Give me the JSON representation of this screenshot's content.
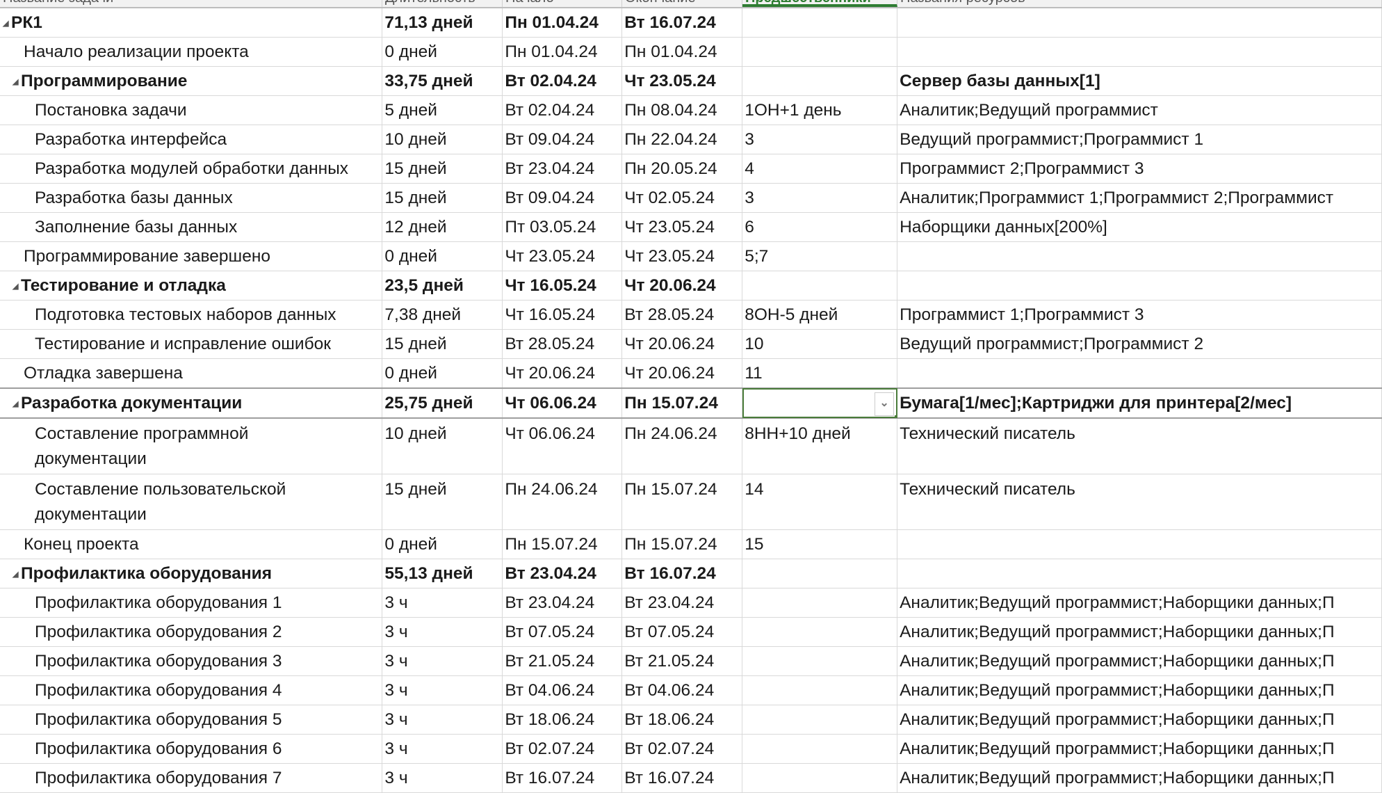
{
  "columns": [
    "Название задачи",
    "Длительность",
    "Начало",
    "Окончание",
    "Предшественники",
    "Названия ресурсов"
  ],
  "selected_column": 4,
  "rows": [
    {
      "name": "РК1",
      "duration": "71,13 дней",
      "start": "Пн 01.04.24",
      "finish": "Вт 16.07.24",
      "pred": "",
      "res": "",
      "level": 0,
      "summary": true
    },
    {
      "name": "Начало реализации проекта",
      "duration": "0 дней",
      "start": "Пн 01.04.24",
      "finish": "Пн 01.04.24",
      "pred": "",
      "res": "",
      "level": 1
    },
    {
      "name": "Программирование",
      "duration": "33,75 дней",
      "start": "Вт 02.04.24",
      "finish": "Чт 23.05.24",
      "pred": "",
      "res": "Сервер базы данных[1]",
      "level": 1,
      "summary": true
    },
    {
      "name": "Постановка задачи",
      "duration": "5 дней",
      "start": "Вт 02.04.24",
      "finish": "Пн 08.04.24",
      "pred": "1ОН+1 день",
      "res": "Аналитик;Ведущий программист",
      "level": 2
    },
    {
      "name": "Разработка интерфейса",
      "duration": "10 дней",
      "start": "Вт 09.04.24",
      "finish": "Пн 22.04.24",
      "pred": "3",
      "res": "Ведущий программист;Программист 1",
      "level": 2
    },
    {
      "name": "Разработка модулей обработки данных",
      "duration": "15 дней",
      "start": "Вт 23.04.24",
      "finish": "Пн 20.05.24",
      "pred": "4",
      "res": "Программист 2;Программист 3",
      "level": 2
    },
    {
      "name": "Разработка базы данных",
      "duration": "15 дней",
      "start": "Вт 09.04.24",
      "finish": "Чт 02.05.24",
      "pred": "3",
      "res": "Аналитик;Программист 1;Программист 2;Программист",
      "level": 2
    },
    {
      "name": "Заполнение базы данных",
      "duration": "12 дней",
      "start": "Пт 03.05.24",
      "finish": "Чт 23.05.24",
      "pred": "6",
      "res": "Наборщики данных[200%]",
      "level": 2
    },
    {
      "name": "Программирование завершено",
      "duration": "0 дней",
      "start": "Чт 23.05.24",
      "finish": "Чт 23.05.24",
      "pred": "5;7",
      "res": "",
      "level": 1
    },
    {
      "name": "Тестирование и отладка",
      "duration": "23,5 дней",
      "start": "Чт 16.05.24",
      "finish": "Чт 20.06.24",
      "pred": "",
      "res": "",
      "level": 1,
      "summary": true
    },
    {
      "name": "Подготовка тестовых наборов данных",
      "duration": "7,38 дней",
      "start": "Чт 16.05.24",
      "finish": "Вт 28.05.24",
      "pred": "8ОН-5 дней",
      "res": "Программист 1;Программист 3",
      "level": 2
    },
    {
      "name": "Тестирование и исправление ошибок",
      "duration": "15 дней",
      "start": "Вт 28.05.24",
      "finish": "Чт 20.06.24",
      "pred": "10",
      "res": "Ведущий программист;Программист 2",
      "level": 2
    },
    {
      "name": "Отладка завершена",
      "duration": "0 дней",
      "start": "Чт 20.06.24",
      "finish": "Чт 20.06.24",
      "pred": "11",
      "res": "",
      "level": 1
    },
    {
      "name": "Разработка документации",
      "duration": "25,75 дней",
      "start": "Чт 06.06.24",
      "finish": "Пн 15.07.24",
      "pred": "",
      "res": "Бумага[1/мес];Картриджи для принтера[2/мес]",
      "level": 1,
      "summary": true,
      "selected": true
    },
    {
      "name": "Составление программной документации",
      "duration": "10 дней",
      "start": "Чт 06.06.24",
      "finish": "Пн 24.06.24",
      "pred": "8НН+10 дней",
      "res": "Технический писатель",
      "level": 2,
      "tall": true
    },
    {
      "name": "Составление пользовательской документации",
      "duration": "15 дней",
      "start": "Пн 24.06.24",
      "finish": "Пн 15.07.24",
      "pred": "14",
      "res": "Технический писатель",
      "level": 2,
      "tall": true
    },
    {
      "name": "Конец проекта",
      "duration": "0 дней",
      "start": "Пн 15.07.24",
      "finish": "Пн 15.07.24",
      "pred": "15",
      "res": "",
      "level": 1
    },
    {
      "name": "Профилактика оборудования",
      "duration": "55,13 дней",
      "start": "Вт 23.04.24",
      "finish": "Вт 16.07.24",
      "pred": "",
      "res": "",
      "level": 1,
      "summary": true
    },
    {
      "name": "Профилактика оборудования 1",
      "duration": "3 ч",
      "start": "Вт 23.04.24",
      "finish": "Вт 23.04.24",
      "pred": "",
      "res": "Аналитик;Ведущий программист;Наборщики данных;П",
      "level": 2
    },
    {
      "name": "Профилактика оборудования 2",
      "duration": "3 ч",
      "start": "Вт 07.05.24",
      "finish": "Вт 07.05.24",
      "pred": "",
      "res": "Аналитик;Ведущий программист;Наборщики данных;П",
      "level": 2
    },
    {
      "name": "Профилактика оборудования 3",
      "duration": "3 ч",
      "start": "Вт 21.05.24",
      "finish": "Вт 21.05.24",
      "pred": "",
      "res": "Аналитик;Ведущий программист;Наборщики данных;П",
      "level": 2
    },
    {
      "name": "Профилактика оборудования 4",
      "duration": "3 ч",
      "start": "Вт 04.06.24",
      "finish": "Вт 04.06.24",
      "pred": "",
      "res": "Аналитик;Ведущий программист;Наборщики данных;П",
      "level": 2
    },
    {
      "name": "Профилактика оборудования 5",
      "duration": "3 ч",
      "start": "Вт 18.06.24",
      "finish": "Вт 18.06.24",
      "pred": "",
      "res": "Аналитик;Ведущий программист;Наборщики данных;П",
      "level": 2
    },
    {
      "name": "Профилактика оборудования 6",
      "duration": "3 ч",
      "start": "Вт 02.07.24",
      "finish": "Вт 02.07.24",
      "pred": "",
      "res": "Аналитик;Ведущий программист;Наборщики данных;П",
      "level": 2
    },
    {
      "name": "Профилактика оборудования 7",
      "duration": "3 ч",
      "start": "Вт 16.07.24",
      "finish": "Вт 16.07.24",
      "pred": "",
      "res": "Аналитик;Ведущий программист;Наборщики данных;П",
      "level": 2
    }
  ],
  "colors": {
    "accent": "#2e7d32",
    "grid": "#d9d9d9"
  }
}
